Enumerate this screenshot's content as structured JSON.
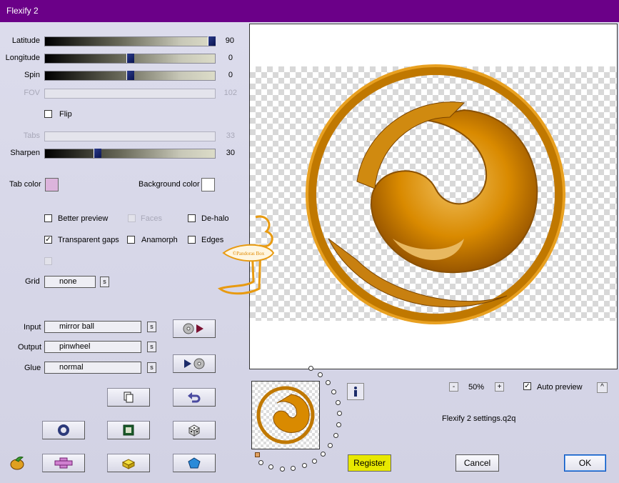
{
  "window": {
    "title": "Flexify 2"
  },
  "sliders": [
    {
      "label": "Latitude",
      "value": "90",
      "level": 1.0,
      "enabled": true
    },
    {
      "label": "Longitude",
      "value": "0",
      "level": 0.5,
      "enabled": true
    },
    {
      "label": "Spin",
      "value": "0",
      "level": 0.5,
      "enabled": true
    },
    {
      "label": "FOV",
      "value": "102",
      "enabled": false
    },
    {
      "label": "Tabs",
      "value": "33",
      "enabled": false
    },
    {
      "label": "Sharpen",
      "value": "30",
      "level": 0.3,
      "enabled": true
    }
  ],
  "flip": {
    "label": "Flip",
    "checked": false
  },
  "colors": {
    "tab_label": "Tab color",
    "tab_value": "#dcb4dc",
    "background_label": "Background color",
    "background_value": "#ffffff"
  },
  "options": {
    "better_preview": "Better preview",
    "faces": "Faces",
    "de_halo": "De-halo",
    "transparent_gaps": "Transparent gaps",
    "anamorph": "Anamorph",
    "edges": "Edges"
  },
  "grid": {
    "label": "Grid",
    "value": "none",
    "s": "s"
  },
  "projection": {
    "input_label": "Input",
    "input_value": "mirror ball",
    "output_label": "Output",
    "output_value": "pinwheel",
    "glue_label": "Glue",
    "glue_value": "normal",
    "s": "s"
  },
  "preview": {
    "zoom": "50%",
    "minus": "-",
    "plus": "+",
    "auto_preview": "Auto preview",
    "auto_checked": true,
    "collapse": "^"
  },
  "settings_file": "Flexify 2 settings.q2q",
  "watermark": "©Pandoras Box",
  "buttons": {
    "register": "Register",
    "cancel": "Cancel",
    "ok": "OK"
  },
  "accent": {
    "title_bar": "#6b0088",
    "register": "#e8e800",
    "orange": "#d98a00"
  }
}
